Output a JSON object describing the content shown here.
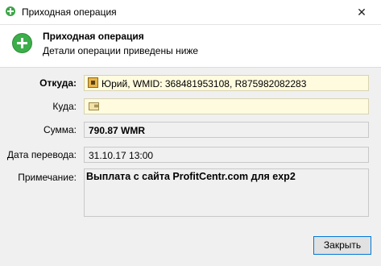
{
  "window": {
    "title": "Приходная операция",
    "close_glyph": "✕",
    "icon": "plus-circle-icon"
  },
  "header": {
    "title": "Приходная операция",
    "subtitle": "Детали операции приведены ниже",
    "icon": "plus-circle-icon"
  },
  "fields": {
    "from": {
      "label": "Откуда:",
      "value": "Юрий, WMID: 368481953108, R875982082283",
      "icon": "wallet-icon"
    },
    "to": {
      "label": "Куда:",
      "value": "",
      "icon": "card-icon"
    },
    "amount": {
      "label": "Сумма:",
      "value": "790.87 WMR"
    },
    "date": {
      "label": "Дата перевода:",
      "value": "31.10.17 13:00"
    },
    "note": {
      "label": "Примечание:",
      "value": "Выплата с сайта ProfitCentr.com для exp2"
    }
  },
  "buttons": {
    "close_label": "Закрыть"
  },
  "colors": {
    "accent": "#0078d7",
    "success": "#3cae4a",
    "highlight_field": "#fffbdf"
  }
}
